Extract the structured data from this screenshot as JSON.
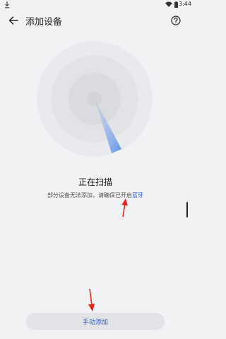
{
  "status_bar": {
    "time": "3:44",
    "icons": [
      "download-icon",
      "wifi-icon",
      "battery-icon"
    ]
  },
  "header": {
    "back_icon": "back-arrow-icon",
    "title": "添加设备",
    "help_icon": "help-icon"
  },
  "scan": {
    "status_text": "正在扫描",
    "hint_prefix": "部分设备无法添加，请确保已开启",
    "hint_link": "蓝牙"
  },
  "footer": {
    "manual_add_label": "手动添加"
  },
  "colors": {
    "background": "#f1f2f4",
    "accent": "#2b63d4",
    "annotation_arrow": "#e8231a",
    "radar_sweep": "#5b8fe6"
  }
}
